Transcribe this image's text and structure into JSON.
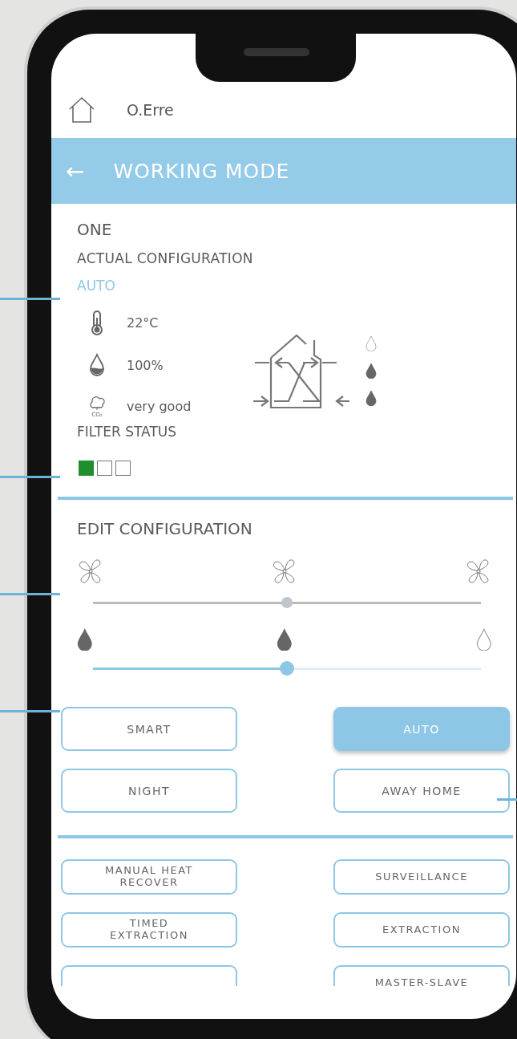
{
  "header": {
    "title": "O.Erre"
  },
  "app_bar": {
    "back": "←",
    "title": "WORKING MODE"
  },
  "device": {
    "name": "ONE",
    "section": "ACTUAL CONFIGURATION",
    "mode": "AUTO"
  },
  "readings": [
    {
      "kind": "temperature",
      "value": "22°C"
    },
    {
      "kind": "humidity",
      "value": "100%"
    },
    {
      "kind": "co2",
      "icon_label": "CO₂",
      "value": "very good"
    }
  ],
  "outlet_drops": [
    {
      "filled": false
    },
    {
      "filled": true
    },
    {
      "filled": true
    }
  ],
  "filter_status": {
    "label": "FILTER STATUS",
    "segments": [
      {
        "filled": true
      },
      {
        "filled": false
      },
      {
        "filled": false
      }
    ]
  },
  "edit": {
    "title": "EDIT CONFIGURATION",
    "fan_slider": {
      "level": 0.5
    },
    "humidity_drops": [
      {
        "filled": true
      },
      {
        "filled": true
      },
      {
        "filled": false
      }
    ],
    "humidity_slider": {
      "level": 0.5
    }
  },
  "modes": [
    {
      "label": "SMART",
      "selected": false
    },
    {
      "label": "AUTO",
      "selected": true
    },
    {
      "label": "NIGHT",
      "selected": false
    },
    {
      "label": "AWAY HOME",
      "selected": false
    }
  ],
  "functions": [
    {
      "label": "MANUAL HEAT RECOVER"
    },
    {
      "label": "SURVEILLANCE"
    },
    {
      "label": "TIMED EXTRACTION"
    },
    {
      "label": "EXTRACTION"
    }
  ],
  "cut_function": {
    "label": "MASTER-SLAVE"
  }
}
